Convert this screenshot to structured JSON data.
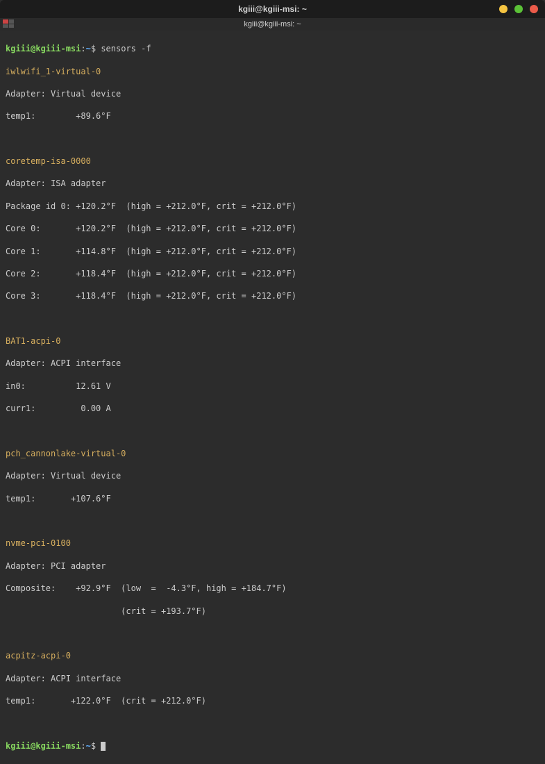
{
  "window": {
    "title": "kgiii@kgiii-msi: ~",
    "tab_title": "kgiii@kgiii-msi: ~"
  },
  "prompt": {
    "user_host": "kgiii@kgiii-msi",
    "colon": ":",
    "path": "~",
    "dollar": "$"
  },
  "command": "sensors -f",
  "output": {
    "iwlwifi": {
      "name": "iwlwifi_1-virtual-0",
      "adapter": "Adapter: Virtual device",
      "temp1": "temp1:        +89.6°F"
    },
    "coretemp": {
      "name": "coretemp-isa-0000",
      "adapter": "Adapter: ISA adapter",
      "pkg": "Package id 0: +120.2°F  (high = +212.0°F, crit = +212.0°F)",
      "core0": "Core 0:       +120.2°F  (high = +212.0°F, crit = +212.0°F)",
      "core1": "Core 1:       +114.8°F  (high = +212.0°F, crit = +212.0°F)",
      "core2": "Core 2:       +118.4°F  (high = +212.0°F, crit = +212.0°F)",
      "core3": "Core 3:       +118.4°F  (high = +212.0°F, crit = +212.0°F)"
    },
    "bat1": {
      "name": "BAT1-acpi-0",
      "adapter": "Adapter: ACPI interface",
      "in0": "in0:          12.61 V",
      "curr1": "curr1:         0.00 A"
    },
    "pch": {
      "name": "pch_cannonlake-virtual-0",
      "adapter": "Adapter: Virtual device",
      "temp1": "temp1:       +107.6°F"
    },
    "nvme": {
      "name": "nvme-pci-0100",
      "adapter": "Adapter: PCI adapter",
      "comp1": "Composite:    +92.9°F  (low  =  -4.3°F, high = +184.7°F)",
      "comp2": "                       (crit = +193.7°F)"
    },
    "acpitz": {
      "name": "acpitz-acpi-0",
      "adapter": "Adapter: ACPI interface",
      "temp1": "temp1:       +122.0°F  (crit = +212.0°F)"
    }
  }
}
